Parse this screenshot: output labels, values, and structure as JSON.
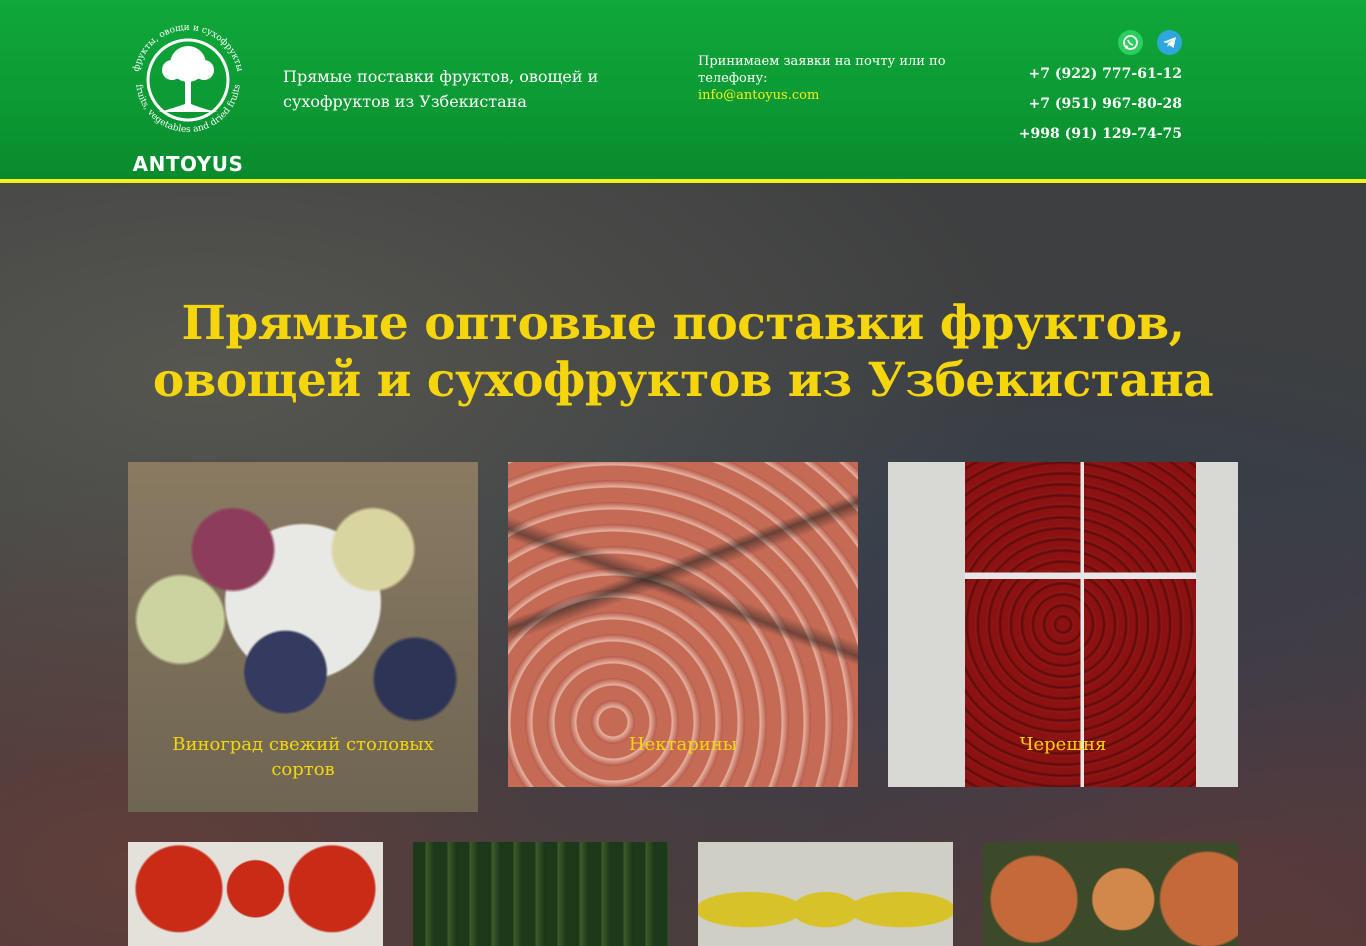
{
  "header": {
    "logo": {
      "brand": "ANTOYUS",
      "arc_top": "фрукты, овощи и сухофрукты",
      "arc_bottom": "fruits, vegetables and dried fruits"
    },
    "tagline": "Прямые поставки фруктов, овощей и сухофруктов из Узбекистана",
    "contact": {
      "text": "Принимаем заявки на почту или по телефону:",
      "email": "info@antoyus.com"
    },
    "messengers": [
      {
        "name": "whatsapp-icon",
        "color": "#2bcf5f"
      },
      {
        "name": "telegram-icon",
        "color": "#2ea7dc"
      }
    ],
    "phones": [
      "+7 (922) 777-61-12",
      "+7 (951) 967-80-28",
      "+998 (91) 129-74-75"
    ]
  },
  "hero": {
    "title": "Прямые оптовые поставки фруктов, овощей и сухофруктов из Узбекистана"
  },
  "products": [
    {
      "label": "Виноград свежий столовых сортов"
    },
    {
      "label": "Нектарины"
    },
    {
      "label": "Черешня"
    }
  ],
  "colors": {
    "header_green": "#0c9a34",
    "accent_yellow": "#f5d60c",
    "line_yellow": "#f2f21a"
  }
}
